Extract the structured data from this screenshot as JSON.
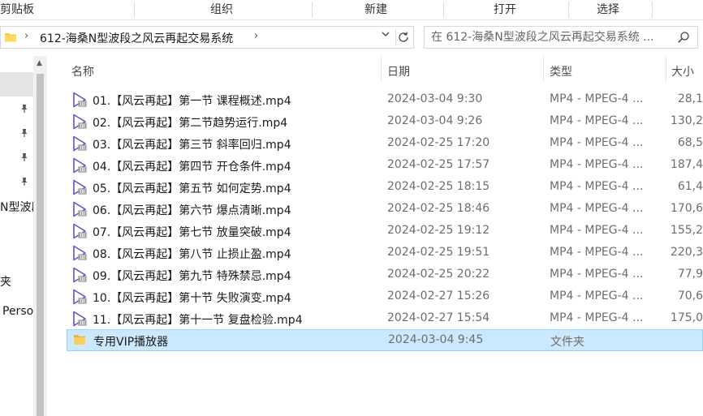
{
  "ribbon": {
    "groups": [
      "剪贴板",
      "组织",
      "新建",
      "打开",
      "选择"
    ]
  },
  "address": {
    "path": "612-海桑N型波段之风云再起交易系统",
    "search_placeholder": "在 612-海桑N型波段之风云再起交易系统 ..."
  },
  "nav": {
    "items": [
      "N型波段",
      "夹",
      "Perso"
    ]
  },
  "columns": {
    "name": "名称",
    "date": "日期",
    "type": "类型",
    "size": "大小"
  },
  "files": [
    {
      "name": "01.【风云再起】第一节 课程概述.mp4",
      "date": "2024-03-04 9:30",
      "type": "MP4 - MPEG-4 ...",
      "size": "28,1"
    },
    {
      "name": "02.【风云再起】第二节趋势运行.mp4",
      "date": "2024-03-04 9:26",
      "type": "MP4 - MPEG-4 ...",
      "size": "130,2"
    },
    {
      "name": "03.【风云再起】第三节 斜率回归.mp4",
      "date": "2024-02-25 17:20",
      "type": "MP4 - MPEG-4 ...",
      "size": "68,5"
    },
    {
      "name": "04.【风云再起】第四节 开仓条件.mp4",
      "date": "2024-02-25 17:57",
      "type": "MP4 - MPEG-4 ...",
      "size": "187,4"
    },
    {
      "name": "05.【风云再起】第五节 如何定势.mp4",
      "date": "2024-02-25 18:15",
      "type": "MP4 - MPEG-4 ...",
      "size": "61,4"
    },
    {
      "name": "06.【风云再起】第六节 爆点清晰.mp4",
      "date": "2024-02-25 18:46",
      "type": "MP4 - MPEG-4 ...",
      "size": "170,6"
    },
    {
      "name": "07.【风云再起】第七节 放量突破.mp4",
      "date": "2024-02-25 19:12",
      "type": "MP4 - MPEG-4 ...",
      "size": "155,2"
    },
    {
      "name": "08.【风云再起】第八节 止损止盈.mp4",
      "date": "2024-02-25 19:51",
      "type": "MP4 - MPEG-4 ...",
      "size": "220,3"
    },
    {
      "name": "09.【风云再起】第九节 特殊禁忌.mp4",
      "date": "2024-02-25 20:22",
      "type": "MP4 - MPEG-4 ...",
      "size": "77,9"
    },
    {
      "name": "10.【风云再起】第十节 失败演变.mp4",
      "date": "2024-02-27 15:26",
      "type": "MP4 - MPEG-4 ...",
      "size": "70,6"
    },
    {
      "name": "11.【风云再起】第十一节 复盘检验.mp4",
      "date": "2024-02-27 15:54",
      "type": "MP4 - MPEG-4 ...",
      "size": "175,0"
    },
    {
      "name": "专用VIP播放器",
      "date": "2024-03-04 9:45",
      "type": "文件夹",
      "size": ""
    }
  ],
  "colors": {
    "selection_bg": "#cce8ff",
    "selection_border": "#99d1ff",
    "video_icon": "#6a4fc8",
    "folder_icon": "#f5c842"
  }
}
